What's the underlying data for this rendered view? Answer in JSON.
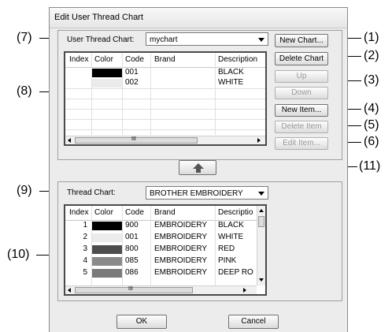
{
  "dialog": {
    "title": "Edit User Thread Chart"
  },
  "callouts": [
    "(1)",
    "(2)",
    "(3)",
    "(4)",
    "(5)",
    "(6)",
    "(7)",
    "(8)",
    "(9)",
    "(10)",
    "(11)"
  ],
  "user_chart": {
    "label": "User Thread Chart:",
    "selected": "mychart",
    "columns": [
      "Index",
      "Color",
      "Code",
      "Brand",
      "Description"
    ],
    "rows": [
      {
        "index": "",
        "color": "#000000",
        "code": "001",
        "brand": "",
        "description": "BLACK"
      },
      {
        "index": "",
        "color": "#ebebeb",
        "code": "002",
        "brand": "",
        "description": "WHITE"
      }
    ]
  },
  "buttons": {
    "new_chart": "New Chart...",
    "delete_chart": "Delete Chart",
    "up": "Up",
    "down": "Down",
    "new_item": "New Item...",
    "delete_item": "Delete Item",
    "edit_item": "Edit Item...",
    "ok": "OK",
    "cancel": "Cancel"
  },
  "thread_chart": {
    "label": "Thread Chart:",
    "selected": "BROTHER EMBROIDERY",
    "columns": [
      "Index",
      "Color",
      "Code",
      "Brand",
      "Descriptio"
    ],
    "rows": [
      {
        "index": "1",
        "color": "#000000",
        "code": "900",
        "brand": "EMBROIDERY",
        "description": "BLACK"
      },
      {
        "index": "2",
        "color": "#ebebeb",
        "code": "001",
        "brand": "EMBROIDERY",
        "description": "WHITE"
      },
      {
        "index": "3",
        "color": "#4d4d4d",
        "code": "800",
        "brand": "EMBROIDERY",
        "description": "RED"
      },
      {
        "index": "4",
        "color": "#8a8a8a",
        "code": "085",
        "brand": "EMBROIDERY",
        "description": "PINK"
      },
      {
        "index": "5",
        "color": "#7a7a7a",
        "code": "086",
        "brand": "EMBROIDERY",
        "description": "DEEP RO"
      }
    ]
  },
  "scrollbar_glyph": "III"
}
